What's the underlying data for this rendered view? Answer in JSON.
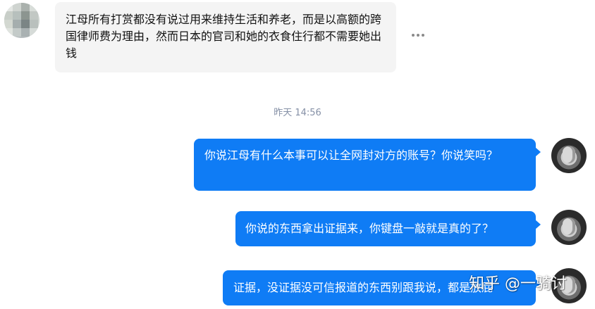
{
  "conversation": {
    "incoming_message": {
      "text": "江母所有打赏都没有说过用来维持生活和养老，而是以高额的跨国律师费为理由，然而日本的官司和她的衣食住行都不需要她出钱"
    },
    "timestamp": "昨天 14:56",
    "outgoing_messages": [
      {
        "text": "你说江母有什么本事可以让全网封对方的账号？你说笑吗？"
      },
      {
        "text": "你说的东西拿出证据来，你键盘一敲就是真的了？"
      },
      {
        "text": "证据，没证据没可信报道的东西别跟我说，都是放屁"
      }
    ]
  },
  "watermark": "知乎 @一骑讨",
  "colors": {
    "outgoing_bubble": "#0f7cf5",
    "incoming_bubble": "#f4f4f4",
    "timestamp": "#8590a6"
  },
  "icons": {
    "more": "more-horizontal-icon"
  }
}
